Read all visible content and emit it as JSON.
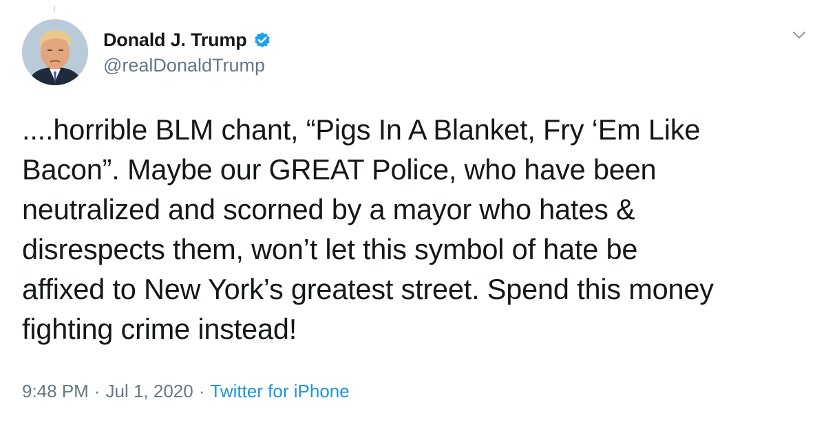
{
  "tweet": {
    "author": {
      "display_name": "Donald J. Trump",
      "handle": "@realDonaldTrump",
      "verified": true,
      "avatar_icon": "profile-photo"
    },
    "text": "....horrible BLM chant, “Pigs In A Blanket, Fry ‘Em Like\nBacon”. Maybe our GREAT Police, who have been\nneutralized and scorned by a mayor who hates &\ndisrespects them, won’t let this symbol of hate be\naffixed to New York’s greatest street. Spend this money\nfighting crime instead!",
    "time": "9:48 PM",
    "date": "Jul 1, 2020",
    "separator": "·",
    "source": "Twitter for iPhone"
  },
  "icons": {
    "verified": "verified-badge-icon",
    "menu": "chevron-down-icon"
  },
  "colors": {
    "text_primary": "#14171a",
    "text_secondary": "#657786",
    "link": "#1b95e0",
    "verified_badge": "#1da1f2"
  }
}
